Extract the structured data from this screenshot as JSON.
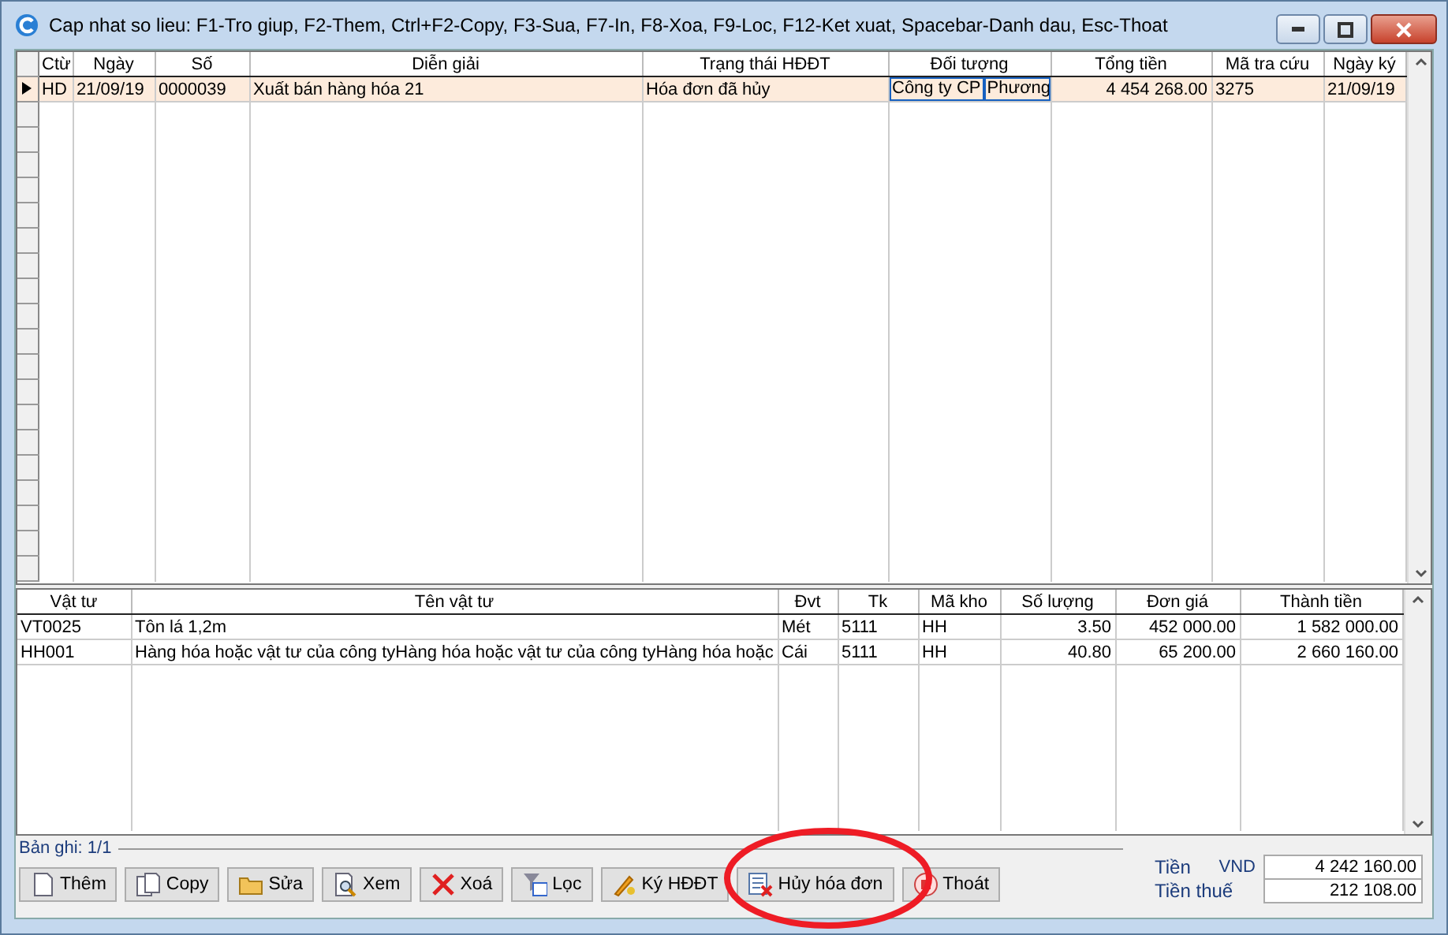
{
  "window": {
    "title": "Cap nhat so lieu: F1-Tro giup, F2-Them, Ctrl+F2-Copy, F3-Sua, F7-In, F8-Xoa, F9-Loc, F12-Ket xuat, Spacebar-Danh dau, Esc-Thoat"
  },
  "vouchers": {
    "columns": [
      "Ctừ",
      "Ngày",
      "Số",
      "Diễn giải",
      "Trạng thái HĐĐT",
      "Đối tượng",
      "Tổng tiền",
      "Mã tra cứu",
      "Ngày ký"
    ],
    "rows": [
      {
        "selected": true,
        "cells": [
          "HD",
          "21/09/19",
          "0000039",
          "Xuất bán hàng hóa 21",
          "Hóa đơn đã hủy",
          [
            "Công ty CP",
            "Phương"
          ],
          "4 454 268.00",
          "3275",
          "21/09/19"
        ]
      }
    ]
  },
  "lines": {
    "columns": [
      "Vật tư",
      "Tên vật tư",
      "Đvt",
      "Tk",
      "Mã kho",
      "Số lượng",
      "Đơn giá",
      "Thành tiền"
    ],
    "rows": [
      {
        "cells": [
          "VT0025",
          "Tôn lá 1,2m",
          "Mét",
          "5111",
          "HH",
          "3.50",
          "452 000.00",
          "1 582 000.00"
        ]
      },
      {
        "cells": [
          "HH001",
          "Hàng hóa hoặc vật tư của công tyHàng hóa hoặc vật tư của công tyHàng hóa hoặc",
          "Cái",
          "5111",
          "HH",
          "40.80",
          "65 200.00",
          "2 660 160.00"
        ]
      }
    ]
  },
  "record_count": "Bản ghi: 1/1",
  "buttons": [
    {
      "kind": "page",
      "label": "Thêm"
    },
    {
      "kind": "pages",
      "label": "Copy"
    },
    {
      "kind": "folder",
      "label": "Sửa"
    },
    {
      "kind": "magnifier",
      "label": "Xem"
    },
    {
      "kind": "cross",
      "label": "Xoá"
    },
    {
      "kind": "funnel",
      "label": "Lọc"
    },
    {
      "kind": "pen",
      "label": "Ký HĐĐT"
    },
    {
      "kind": "cancel",
      "label": "Hủy hóa đơn"
    },
    {
      "kind": "stop",
      "label": "Thoát"
    }
  ],
  "totals": [
    {
      "label": "Tiền",
      "currency": "VND",
      "value": "4 242 160.00"
    },
    {
      "label": "Tiền thuế",
      "value": "212 108.00"
    }
  ],
  "annotations": [
    {
      "kind": "ellipse",
      "color": "#ee1c25"
    }
  ]
}
